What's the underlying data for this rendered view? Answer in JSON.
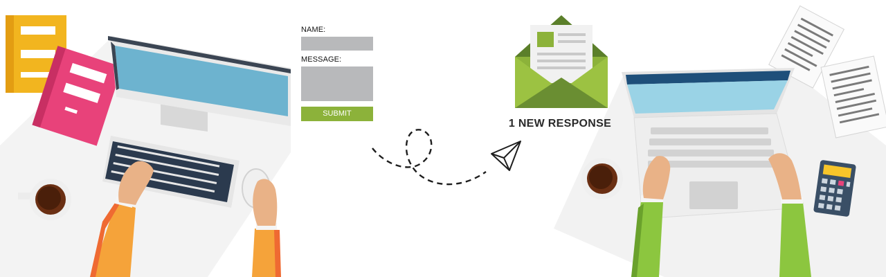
{
  "form": {
    "name_label": "NAME:",
    "message_label": "MESSAGE:",
    "submit_label": "SUBMIT"
  },
  "notification": {
    "text": "1 NEW RESPONSE"
  },
  "colors": {
    "accent_green": "#8cb23a",
    "envelope_dark": "#5b7f2a",
    "screen_blue": "#6db3cf",
    "field_gray": "#b8b9bb"
  },
  "icons": [
    "books-icon",
    "desktop-monitor-icon",
    "keyboard-icon",
    "mouse-icon",
    "coffee-cup-icon",
    "envelope-icon",
    "paper-plane-icon",
    "laptop-icon",
    "documents-icon",
    "calculator-icon"
  ]
}
